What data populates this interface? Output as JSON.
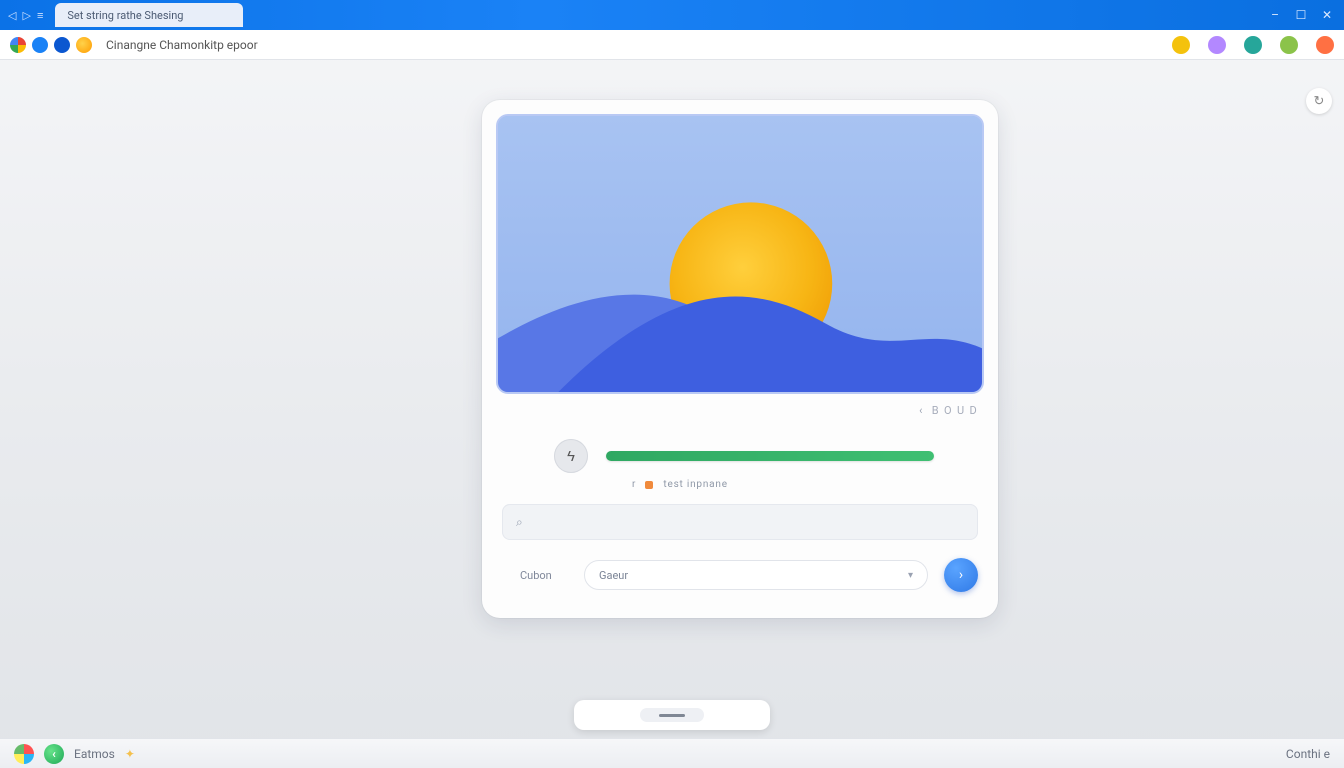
{
  "titlebar": {
    "tab_title": "Set string rathe Shesing",
    "win_minimize": "–",
    "win_maximize": "☐",
    "win_close": "✕"
  },
  "toolbar": {
    "url_text": "Cinangne Chamonkitp epoor"
  },
  "side_action": {
    "glyph": "↻"
  },
  "card": {
    "hero_meta_chevron": "‹",
    "hero_meta_text": "B O U D",
    "progress_button_glyph": "ϟ",
    "flag_marker": "r",
    "flag_label": "test inpnane",
    "search_placeholder": "",
    "search_icon": "⌕",
    "category_label": "Cubon",
    "select_value": "Gaeur",
    "select_caret": "▾",
    "go_glyph": "›"
  },
  "taskbar": {
    "app_label": "Eatmos",
    "right_text": "Conthi e"
  }
}
